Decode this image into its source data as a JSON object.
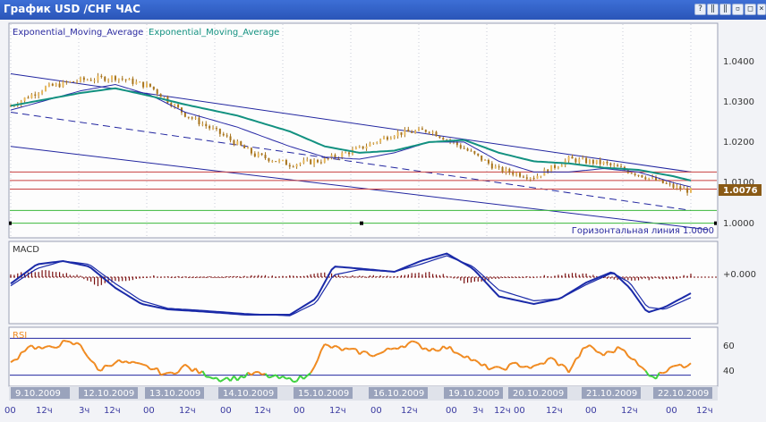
{
  "window": {
    "title": "График USD /CHF  ЧАС",
    "buttons": [
      {
        "icon": "help-icon",
        "glyph": "?"
      },
      {
        "icon": "pause-icon",
        "glyph": "‖"
      },
      {
        "icon": "pause-alt-icon",
        "glyph": "‖"
      },
      {
        "icon": "minimize-icon",
        "glyph": "▫"
      },
      {
        "icon": "maximize-icon",
        "glyph": "□"
      },
      {
        "icon": "close-icon",
        "glyph": "×"
      }
    ]
  },
  "colors": {
    "candle_up": "#e8b85a",
    "candle_down": "#a8741c",
    "ema_slow": "#129180",
    "ema_fast": "#282aa6",
    "channel": "#2226a0",
    "red_levels": "#c84040",
    "green_levels": "#3cb83c",
    "macd_hist": "#7a1010",
    "macd_lines": "#1a2aa8",
    "rsi": "#f08a20",
    "rsi_low": "#3ed23e",
    "price_tag": "#8a5a16"
  },
  "main_panel": {
    "legend": [
      "Exponential_Moving_Average",
      "Exponential_Moving_Average"
    ],
    "y_ticks": [
      "1.0400",
      "1.0300",
      "1.0200",
      "1.0100",
      "1.0000"
    ],
    "current_price": "1.0076",
    "horizontal_line_label": "Горизонтальная линия 1.0000"
  },
  "macd_panel": {
    "title": "MACD",
    "y_tick": "+0.000"
  },
  "rsi_panel": {
    "title": "RSI",
    "y_ticks": [
      "60",
      "40"
    ]
  },
  "time_axis": {
    "dates": [
      "9.10.2009",
      "12.10.2009",
      "13.10.2009",
      "14.10.2009",
      "15.10.2009",
      "16.10.2009",
      "19.10.2009",
      "20.10.2009",
      "21.10.2009",
      "22.10.2009"
    ],
    "hours": [
      "00",
      "12ч",
      "3ч",
      "12ч",
      "00",
      "12ч",
      "00",
      "12ч",
      "00",
      "12ч",
      "00",
      "12ч",
      "00",
      "3ч",
      "12ч",
      "00",
      "12ч",
      "00",
      "12ч",
      "00",
      "12ч"
    ]
  },
  "chart_data": [
    {
      "type": "line",
      "title": "",
      "xlabel": "",
      "ylabel": "",
      "x_label_ticks": [
        "9.10.2009",
        "12.10.2009",
        "13.10.2009",
        "14.10.2009",
        "15.10.2009",
        "16.10.2009",
        "19.10.2009",
        "20.10.2009",
        "21.10.2009",
        "22.10.2009"
      ],
      "ylim": [
        0.997,
        1.046
      ],
      "series": [
        {
          "points_i": [
            0,
            20,
            40,
            60,
            80,
            100,
            120,
            140,
            160,
            180,
            200,
            220,
            240,
            260,
            280,
            300,
            320,
            340,
            360,
            380,
            390
          ],
          "values": [
            1.0275,
            1.0318,
            1.0335,
            1.0342,
            1.032,
            1.0255,
            1.021,
            1.016,
            1.0138,
            1.0148,
            1.0175,
            1.021,
            1.0218,
            1.0175,
            1.0125,
            1.0108,
            1.015,
            1.014,
            1.0115,
            1.0085,
            1.0075
          ]
        },
        {
          "name": "Exponential_Moving_Average",
          "points_i": [
            0,
            40,
            60,
            80,
            100,
            130,
            160,
            180,
            200,
            220,
            240,
            260,
            280,
            300,
            320,
            340,
            360,
            380,
            390
          ],
          "values": [
            1.0275,
            1.0305,
            1.0316,
            1.0298,
            1.0278,
            1.0252,
            1.0215,
            1.018,
            1.0165,
            1.017,
            1.019,
            1.0195,
            1.0165,
            1.0145,
            1.014,
            1.013,
            1.0125,
            1.011,
            1.01
          ]
        },
        {
          "name": "Exponential_Moving_Average",
          "points_i": [
            0,
            40,
            60,
            80,
            100,
            130,
            160,
            180,
            200,
            220,
            240,
            260,
            280,
            300,
            320,
            340,
            360,
            380,
            390
          ],
          "values": [
            1.0265,
            1.031,
            1.0325,
            1.03,
            1.026,
            1.0225,
            1.018,
            1.0155,
            1.015,
            1.0165,
            1.019,
            1.019,
            1.0145,
            1.012,
            1.012,
            1.0128,
            1.012,
            1.0095,
            1.0085
          ]
        }
      ],
      "horizontal_levels": {
        "red": [
          1.012,
          1.01,
          1.008
        ],
        "green": [
          1.003,
          1.0
        ]
      }
    },
    {
      "type": "bar",
      "title": "MACD",
      "ylim": [
        -0.004,
        0.003
      ],
      "hist_points_i": [
        0,
        10,
        20,
        30,
        40,
        50,
        60,
        70,
        80,
        90,
        100,
        120,
        140,
        160,
        170,
        180,
        190,
        200,
        210,
        220,
        230,
        240,
        250,
        260,
        270,
        280,
        290,
        300,
        310,
        320,
        330,
        340,
        350,
        360,
        370,
        380,
        390
      ],
      "hist_values": [
        0.0002,
        0.0005,
        0.0006,
        0.0004,
        0.0001,
        -0.0008,
        -0.0004,
        -0.0002,
        0.0001,
        0.0,
        0.0,
        0.0,
        0.0001,
        0.0001,
        0.0002,
        0.0004,
        0.0001,
        0.0001,
        0.0001,
        0.0001,
        0.0003,
        0.0004,
        0.0002,
        -0.0005,
        -0.0004,
        -0.0001,
        0.0,
        0.0001,
        0.0001,
        0.0003,
        0.0003,
        -0.0001,
        -0.0002,
        -0.0003,
        -0.0001,
        -0.0002,
        0.0003
      ],
      "series": [
        {
          "points_i": [
            0,
            15,
            30,
            45,
            60,
            75,
            90,
            110,
            135,
            160,
            175,
            185,
            200,
            220,
            235,
            250,
            265,
            280,
            300,
            315,
            330,
            345,
            355,
            365,
            375,
            390
          ],
          "values": [
            -0.0006,
            0.0012,
            0.0015,
            0.001,
            -0.001,
            -0.0025,
            -0.003,
            -0.0032,
            -0.0035,
            -0.0035,
            -0.002,
            0.001,
            0.0008,
            0.0005,
            0.0015,
            0.0022,
            0.0008,
            -0.0018,
            -0.0025,
            -0.002,
            -0.0005,
            0.0005,
            -0.001,
            -0.0033,
            -0.0028,
            -0.0015
          ]
        },
        {
          "points_i": [
            0,
            15,
            30,
            45,
            60,
            75,
            90,
            110,
            135,
            160,
            175,
            185,
            200,
            220,
            235,
            250,
            265,
            280,
            300,
            315,
            330,
            345,
            355,
            365,
            375,
            390
          ],
          "values": [
            -0.0008,
            0.0008,
            0.0015,
            0.0012,
            -0.0006,
            -0.0022,
            -0.0029,
            -0.0031,
            -0.0034,
            -0.0036,
            -0.0024,
            0.0002,
            0.0007,
            0.0005,
            0.0012,
            0.002,
            0.001,
            -0.0012,
            -0.0022,
            -0.002,
            -0.0007,
            0.0004,
            -0.0005,
            -0.0028,
            -0.003,
            -0.0019
          ]
        }
      ]
    },
    {
      "type": "line",
      "title": "RSI",
      "ylim": [
        20,
        80
      ],
      "upper_band": 70,
      "lower_band": 30,
      "series": [
        {
          "points_i": [
            0,
            10,
            20,
            30,
            40,
            50,
            60,
            70,
            80,
            90,
            100,
            104,
            110,
            120,
            130,
            140,
            150,
            160,
            170,
            180,
            190,
            200,
            210,
            220,
            230,
            240,
            250,
            260,
            270,
            280,
            290,
            300,
            310,
            320,
            330,
            340,
            350,
            355,
            360,
            365,
            370,
            375,
            380,
            385,
            390
          ],
          "values": [
            42,
            62,
            58,
            65,
            63,
            35,
            45,
            42,
            38,
            30,
            40,
            36,
            32,
            26,
            27,
            32,
            28,
            25,
            28,
            62,
            58,
            55,
            52,
            60,
            65,
            58,
            60,
            52,
            40,
            36,
            42,
            38,
            48,
            35,
            62,
            52,
            60,
            52,
            40,
            33,
            28,
            35,
            42,
            38,
            45
          ]
        }
      ]
    }
  ]
}
